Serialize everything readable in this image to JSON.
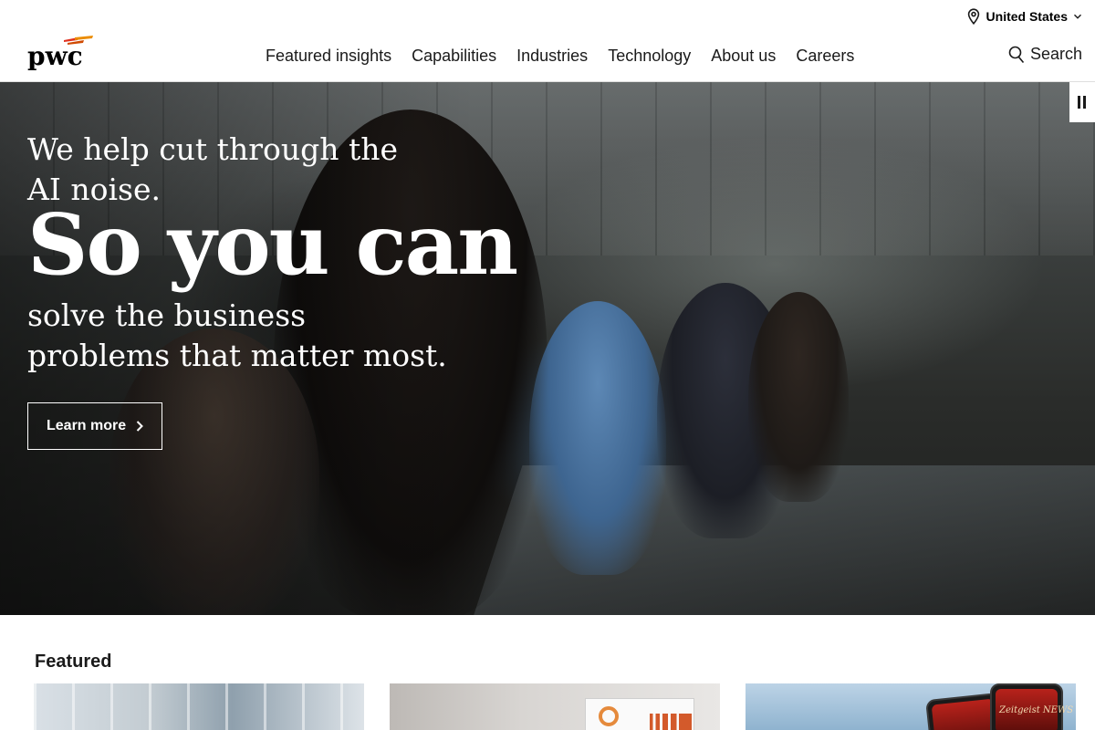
{
  "topbar": {
    "region_label": "United States",
    "region_icon": "location-pin-icon"
  },
  "header": {
    "logo_text": "pwc",
    "brand_color": "#d04a02",
    "nav": [
      {
        "label": "Featured insights"
      },
      {
        "label": "Capabilities"
      },
      {
        "label": "Industries"
      },
      {
        "label": "Technology"
      },
      {
        "label": "About us"
      },
      {
        "label": "Careers"
      }
    ],
    "search_label": "Search"
  },
  "hero": {
    "lead": "We help cut through the AI noise.",
    "headline": "So you can",
    "sub": "solve the business problems that matter most.",
    "cta_label": "Learn more",
    "pause_icon": "pause-icon"
  },
  "featured": {
    "title": "Featured",
    "cards": [
      {
        "image": "office-building-interior"
      },
      {
        "image": "presentation-screen-chart"
      },
      {
        "image": "mobile-app-phones",
        "text": "Zeitgeist NEWS FEED"
      }
    ]
  }
}
